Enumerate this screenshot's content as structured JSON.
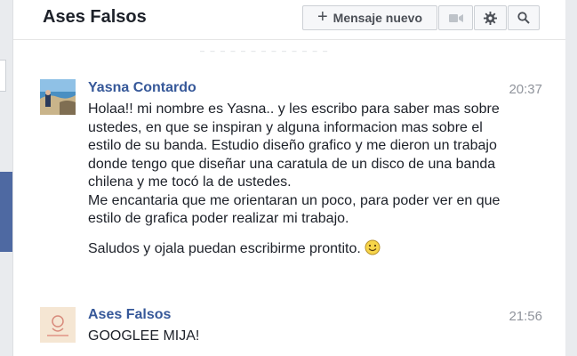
{
  "header": {
    "title": "Ases Falsos",
    "new_message_label": "Mensaje nuevo",
    "icons": {
      "plus": "plus-icon",
      "video": "video-camera-icon",
      "gear": "gear-icon",
      "search": "search-icon"
    }
  },
  "messages": [
    {
      "sender": "Yasna Contardo",
      "time": "20:37",
      "paragraphs": [
        "Holaa!! mi nombre es Yasna.. y les escribo para saber mas sobre ustedes, en que se inspiran y alguna informacion mas sobre el estilo de su banda. Estudio diseño grafico y me dieron un trabajo donde tengo que  diseñar una caratula de un disco de una banda chilena y me tocó la de ustedes.",
        "Me encantaria que me orientaran un poco, para poder ver en que estilo de grafica poder realizar mi trabajo.",
        "Saludos y ojala puedan escribirme prontito."
      ],
      "emoji": "smiley-icon"
    },
    {
      "sender": "Ases Falsos",
      "time": "21:56",
      "paragraphs": [
        "GOOGLEE MIJA!"
      ]
    }
  ],
  "colors": {
    "link_blue": "#365899",
    "sidebar_blue": "#4e69a2",
    "muted": "#90949c"
  }
}
